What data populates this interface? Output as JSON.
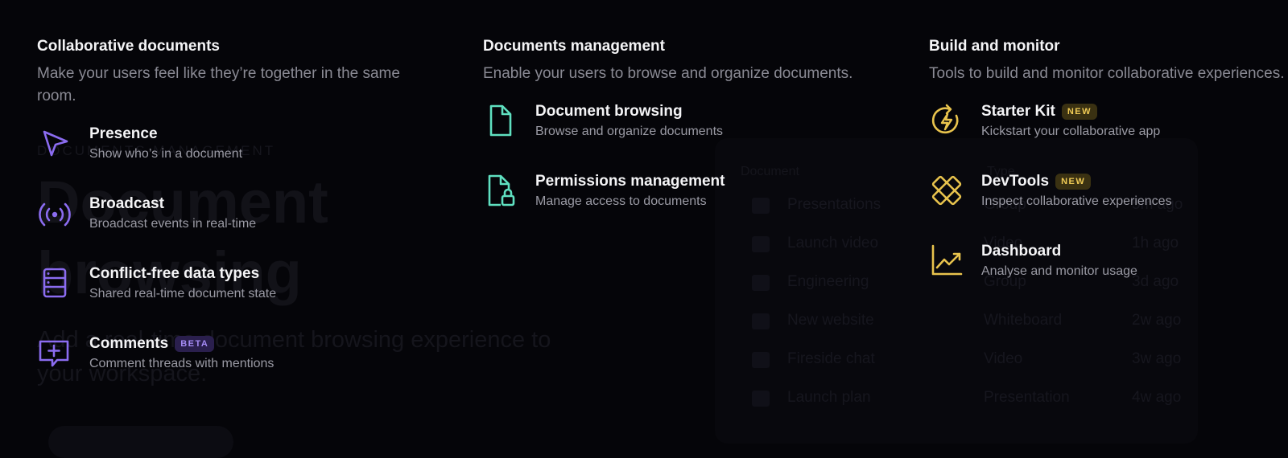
{
  "background": {
    "eyebrow": "Documents management",
    "title": "Document browsing",
    "description": "Add a real-time document browsing experience to your workspace.",
    "panel_header": "Document",
    "panel_header_right": "Type",
    "rows": [
      {
        "name": "Presentations",
        "type": "Group",
        "time": "5m ago"
      },
      {
        "name": "Launch video",
        "type": "Video",
        "time": "1h ago"
      },
      {
        "name": "Engineering",
        "type": "Group",
        "time": "3d ago"
      },
      {
        "name": "New website",
        "type": "Whiteboard",
        "time": "2w ago"
      },
      {
        "name": "Fireside chat",
        "type": "Video",
        "time": "3w ago"
      },
      {
        "name": "Launch plan",
        "type": "Presentation",
        "time": "4w ago"
      }
    ]
  },
  "columns": [
    {
      "title": "Collaborative documents",
      "description": "Make your users feel like they’re together in the same room.",
      "icon_color": "#8b6cf0",
      "items": [
        {
          "icon": "cursor-icon",
          "title": "Presence",
          "desc": "Show who’s in a document",
          "badge": ""
        },
        {
          "icon": "broadcast-icon",
          "title": "Broadcast",
          "desc": "Broadcast events in real-time",
          "badge": ""
        },
        {
          "icon": "database-icon",
          "title": "Conflict-free data types",
          "desc": "Shared real-time document state",
          "badge": ""
        },
        {
          "icon": "comment-icon",
          "title": "Comments",
          "desc": "Comment threads with mentions",
          "badge": "BETA"
        }
      ]
    },
    {
      "title": "Documents management",
      "description": "Enable your users to browse and organize documents.",
      "icon_color": "#5fe0c0",
      "items": [
        {
          "icon": "file-icon",
          "title": "Document browsing",
          "desc": "Browse and organize documents",
          "badge": ""
        },
        {
          "icon": "file-lock-icon",
          "title": "Permissions management",
          "desc": "Manage access to documents",
          "badge": ""
        }
      ]
    },
    {
      "title": "Build and monitor",
      "description": "Tools to build and monitor collaborative experiences.",
      "icon_color": "#e8c34d",
      "items": [
        {
          "icon": "starter-kit-icon",
          "title": "Starter Kit",
          "desc": "Kickstart your collaborative app",
          "badge": "NEW"
        },
        {
          "icon": "devtools-icon",
          "title": "DevTools",
          "desc": "Inspect collaborative experiences",
          "badge": "NEW"
        },
        {
          "icon": "chart-icon",
          "title": "Dashboard",
          "desc": "Analyse and monitor usage",
          "badge": ""
        }
      ]
    }
  ]
}
